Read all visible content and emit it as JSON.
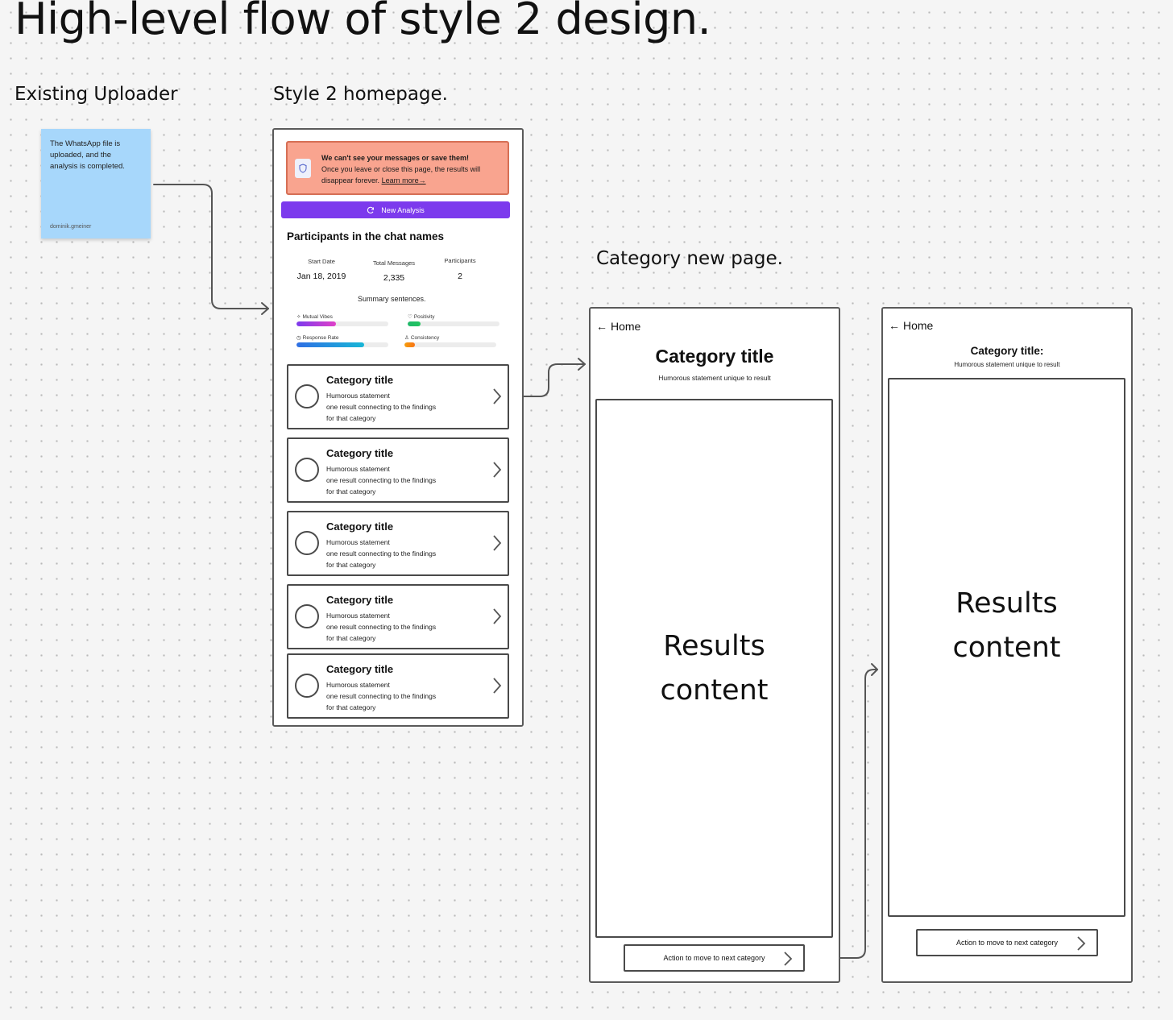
{
  "title": "High-level flow of style 2 design.",
  "sections": {
    "uploader": "Existing Uploader",
    "homepage": "Style 2 homepage.",
    "category": "Category new page."
  },
  "sticky_note": {
    "text": "The WhatsApp file is uploaded, and the analysis is completed.",
    "author": "dominik.gmeiner"
  },
  "homepage": {
    "warning": {
      "title": "We can't see your messages or save them!",
      "body": "Once you leave or close this page, the results will disappear forever.",
      "link": "Learn more→",
      "icon": "shield-icon"
    },
    "new_analysis_label": "New Analysis",
    "participants_title": "Participants in the chat names",
    "stats": [
      {
        "label": "Start Date",
        "value": "Jan 18, 2019"
      },
      {
        "label": "Total Messages",
        "value": "2,335"
      },
      {
        "label": "Participants",
        "value": "2"
      }
    ],
    "summary": "Summary sentences.",
    "metrics": [
      {
        "label": "Mutual Vibes",
        "icon": "sparkle-icon",
        "level": 0.43,
        "colors": [
          "#7c3aed",
          "#e040c8"
        ]
      },
      {
        "label": "Positivity",
        "icon": "heart-icon",
        "level": 0.14,
        "colors": [
          "#1fb86a",
          "#22c55e"
        ]
      },
      {
        "label": "Response Rate",
        "icon": "clock-icon",
        "level": 0.74,
        "colors": [
          "#2f6fe4",
          "#18b6d6"
        ]
      },
      {
        "label": "Consistency",
        "icon": "trophy-icon",
        "level": 0.11,
        "colors": [
          "#f59e0b",
          "#f97316"
        ]
      }
    ],
    "cards": [
      {
        "title": "Category title",
        "line1": "Humorous statement",
        "line2": "one result connecting to the findings",
        "line3": "for that category"
      },
      {
        "title": "Category title",
        "line1": "Humorous statement",
        "line2": "one result connecting to the findings",
        "line3": "for that category"
      },
      {
        "title": "Category title",
        "line1": "Humorous statement",
        "line2": "one result connecting to the findings",
        "line3": "for that category"
      },
      {
        "title": "Category title",
        "line1": "Humorous statement",
        "line2": "one result connecting to the findings",
        "line3": "for that category"
      },
      {
        "title": "Category title",
        "line1": "Humorous statement",
        "line2": "one result connecting to the findings",
        "line3": "for that category"
      }
    ]
  },
  "category_page_a": {
    "home": "Home",
    "title": "Category title",
    "subtitle": "Humorous statement unique to result",
    "results_line1": "Results",
    "results_line2": "content",
    "action": "Action to move to next category"
  },
  "category_page_b": {
    "home": "Home",
    "title": "Category title:",
    "subtitle": "Humorous statement unique to result",
    "results_line1": "Results",
    "results_line2": "content",
    "action": "Action to move to next category"
  },
  "colors": {
    "sticky": "#a7d7fb",
    "warning_bg": "#f9a48f",
    "accent": "#7c3aed",
    "frame_border": "#5a5a5a"
  }
}
